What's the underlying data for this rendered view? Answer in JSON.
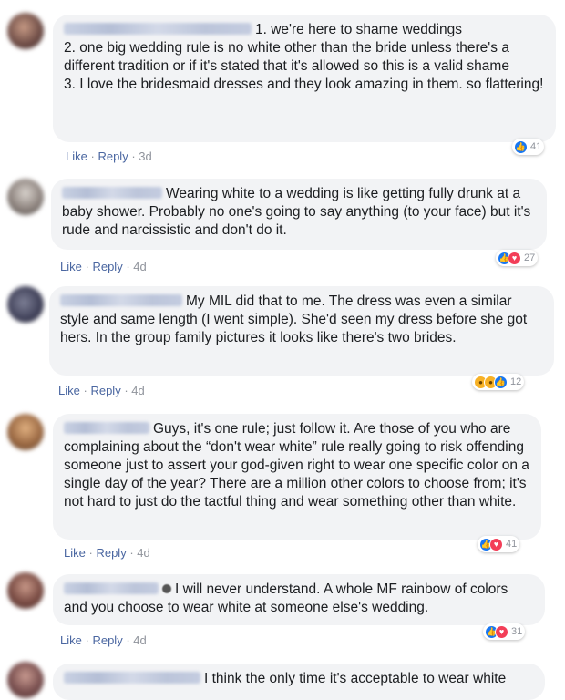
{
  "actions": {
    "like": "Like",
    "reply": "Reply",
    "separator": "·"
  },
  "colors": {
    "bubble": "#f2f3f5",
    "link": "#4b67a1",
    "like_reaction": "#1877f2",
    "love_reaction": "#f33e58"
  },
  "comments": [
    {
      "text_lines": [
        "1. we're here to shame weddings",
        "2. one big wedding rule is no white other than the bride unless there's a different tradition or if it's stated that it's allowed so this is a valid shame",
        "3. I love the bridesmaid dresses and they look amazing in them. so flattering!"
      ],
      "time": "3d",
      "reactions": [
        "like-icon"
      ],
      "reaction_count": "41"
    },
    {
      "text_lines": [
        "Wearing white to a wedding is like getting fully drunk at a baby shower. Probably no one's going to say anything (to your face) but it's rude and narcissistic and don't do it."
      ],
      "time": "4d",
      "reactions": [
        "like-icon",
        "love-icon"
      ],
      "reaction_count": "27"
    },
    {
      "text_lines": [
        "My MIL did that to me. The dress was even a similar style and same length (I went simple). She'd seen my dress before she got hers. In the group family pictures it looks like there's two brides."
      ],
      "time": "4d",
      "reactions": [
        "wow-icon",
        "sad-icon",
        "like-icon"
      ],
      "reaction_count": "12"
    },
    {
      "text_lines": [
        "Guys, it's one rule; just follow it. Are those of you who are complaining about the “don't wear white” rule really going to risk offending someone just to assert your god-given right to wear one specific color on a single day of the year? There are a million other colors to choose from; it's not hard to just do the tactful thing and wear something other than white."
      ],
      "time": "4d",
      "reactions": [
        "like-icon",
        "love-icon"
      ],
      "reaction_count": "41"
    },
    {
      "text_lines": [
        "I will never understand. A whole MF rainbow of colors and you choose to wear white at someone else's wedding."
      ],
      "time": "4d",
      "reactions": [
        "like-icon",
        "love-icon"
      ],
      "reaction_count": "31"
    },
    {
      "text_lines": [
        "I think the only time it's acceptable to wear white"
      ],
      "time": "",
      "reactions": [],
      "reaction_count": ""
    }
  ]
}
